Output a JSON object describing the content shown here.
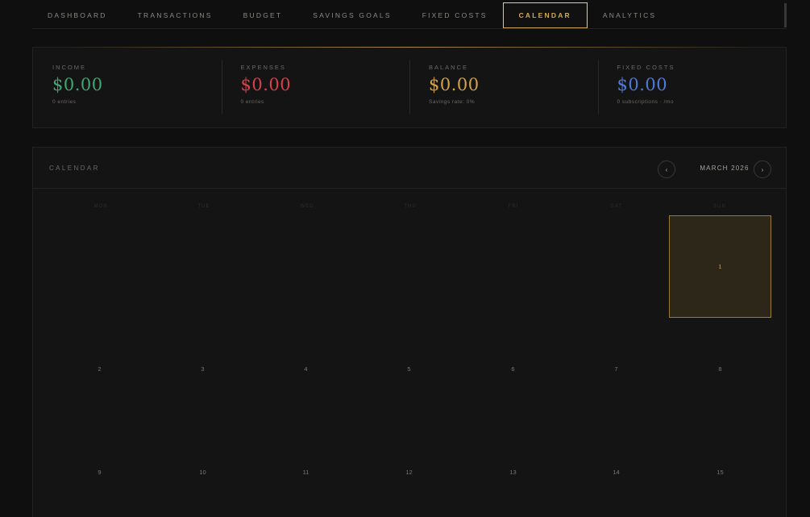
{
  "nav": {
    "tabs": [
      {
        "label": "DASHBOARD"
      },
      {
        "label": "TRANSACTIONS"
      },
      {
        "label": "BUDGET"
      },
      {
        "label": "SAVINGS GOALS"
      },
      {
        "label": "FIXED COSTS"
      },
      {
        "label": "CALENDAR"
      },
      {
        "label": "ANALYTICS"
      }
    ],
    "active": "CALENDAR"
  },
  "summary": {
    "income": {
      "label": "INCOME",
      "value": "$0.00",
      "sub": "0 entries",
      "color": "#3fa870"
    },
    "expenses": {
      "label": "EXPENSES",
      "value": "$0.00",
      "sub": "0 entries",
      "color": "#d8404a"
    },
    "balance": {
      "label": "BALANCE",
      "value": "$0.00",
      "sub": "Savings rate: 0%",
      "color": "#d3a247"
    },
    "fixed_costs": {
      "label": "FIXED COSTS",
      "value": "$0.00",
      "sub": "0 subscriptions · /mo",
      "color": "#4f7ad8"
    }
  },
  "calendar": {
    "title": "CALENDAR",
    "month": "MARCH 2026",
    "prev_icon": "‹",
    "next_icon": "›",
    "weekdays": [
      "MON",
      "TUE",
      "WED",
      "THU",
      "FRI",
      "SAT",
      "SUN"
    ],
    "days": [
      "1",
      "2",
      "3",
      "4",
      "5",
      "6",
      "7",
      "8",
      "9",
      "10",
      "11",
      "12",
      "13",
      "14",
      "15"
    ],
    "today": "1",
    "accent": "#c9a347"
  }
}
